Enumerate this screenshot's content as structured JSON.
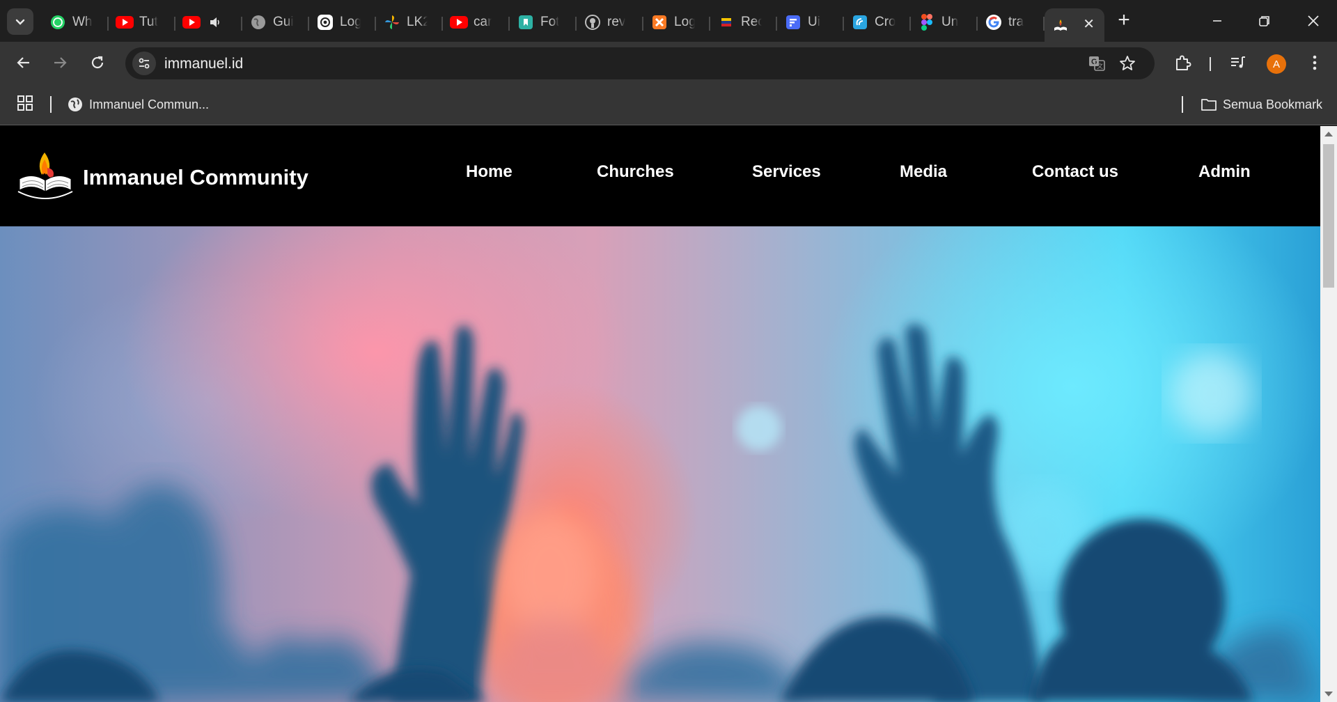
{
  "browser": {
    "tabs": [
      {
        "title": "Wh",
        "icon": "whatsapp-icon",
        "color": "#25d366"
      },
      {
        "title": "Tut",
        "icon": "youtube-icon",
        "color": "#ff0000"
      },
      {
        "title": "",
        "icon": "youtube-icon",
        "color": "#ff0000",
        "audio": true
      },
      {
        "title": "Gui",
        "icon": "globe-icon",
        "color": "#bdbdbd"
      },
      {
        "title": "Log",
        "icon": "chatgpt-icon",
        "color": "#ffffff"
      },
      {
        "title": "LK2",
        "icon": "pinwheel-icon",
        "color": "#e74c3c"
      },
      {
        "title": "car",
        "icon": "youtube-icon",
        "color": "#ff0000"
      },
      {
        "title": "Fot",
        "icon": "bookmark-app-icon",
        "color": "#2db1a4"
      },
      {
        "title": "rev",
        "icon": "github-icon",
        "color": "#bdbdbd"
      },
      {
        "title": "Log",
        "icon": "xampp-icon",
        "color": "#fb7a24"
      },
      {
        "title": "Rec",
        "icon": "flag-icon",
        "color": "#f5c400"
      },
      {
        "title": "Ui",
        "icon": "forms-icon",
        "color": "#4a6cf7"
      },
      {
        "title": "Cro",
        "icon": "crowdin-icon",
        "color": "#2aa5e0"
      },
      {
        "title": "Un",
        "icon": "figma-icon",
        "color": "#f24e1e"
      },
      {
        "title": "tra",
        "icon": "google-icon",
        "color": "#4285f4"
      },
      {
        "title": "",
        "icon": "immanuel-logo-icon",
        "color": "#e53935",
        "active": true
      }
    ],
    "address": {
      "url": "immanuel.id"
    },
    "profile_initial": "A",
    "bookmarks": {
      "item_label": "Immanuel Commun...",
      "all_label": "Semua Bookmark"
    }
  },
  "site": {
    "brand": "Immanuel Community",
    "nav": {
      "home": "Home",
      "churches": "Churches",
      "services": "Services",
      "media": "Media",
      "contact": "Contact us",
      "admin": "Admin"
    }
  },
  "colors": {
    "tabstrip": "#1f1f1f",
    "toolbar": "#353535",
    "header": "#000000",
    "hero_pink": "#d8a0b8",
    "hero_cyan": "#4fd6f5",
    "silhouette": "#1a4f7a"
  }
}
